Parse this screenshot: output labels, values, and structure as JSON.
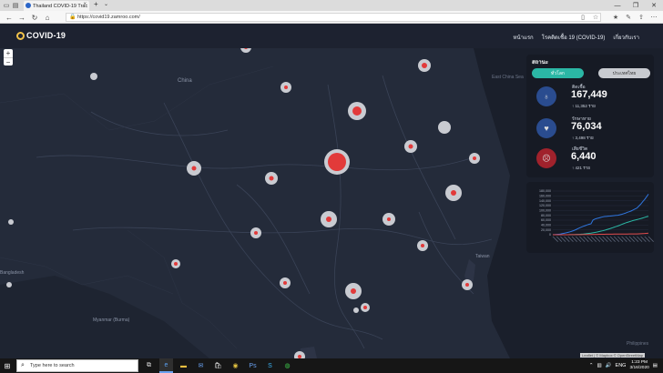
{
  "browser": {
    "tab_title": "Thailand COVID-19 Trac",
    "tab_close": "×",
    "new_tab": "+",
    "tab_dropdown": "⌄",
    "url": "https://covid19.zamroo.com/",
    "window_controls": [
      "—",
      "❐",
      "✕"
    ]
  },
  "app": {
    "logo_text": "COVID-19",
    "nav": [
      "หน้าแรก",
      "โรคติดเชื้อ 19 (COVID-19)",
      "เกี่ยวกับเรา"
    ]
  },
  "map": {
    "zoom_in": "+",
    "zoom_out": "−",
    "attribution": "Leaflet | © Mapbox © OpenStreetMap",
    "labels": [
      "China",
      "Taiwan",
      "Myanmar (Burma)",
      "Bangladesh",
      "East China Sea",
      "Philippines"
    ],
    "label_china": "China",
    "label_taiwan": "Taiwan",
    "label_myanmar": "Myanmar\n(Burma)",
    "label_bangladesh": "Bangladesh",
    "label_sea": "East China Sea",
    "label_phil": "Philippines"
  },
  "panel": {
    "title": "สถานะ",
    "tab_active": "ทั่วโลก",
    "tab_inactive": "ประเทศไทย",
    "stats": [
      {
        "label": "ติดเชื้อ",
        "value": "167,449",
        "delta": "↑ 11,352 ราย",
        "color": "#2a4c8f",
        "icon": "virus-icon"
      },
      {
        "label": "รักษาหาย",
        "value": "76,034",
        "delta": "↑ 3,498 ราย",
        "color": "#2a4c8f",
        "icon": "heart-icon"
      },
      {
        "label": "เสียชีวิต",
        "value": "6,440",
        "delta": "↑ 421 ราย",
        "color": "#a0222c",
        "icon": "skull-icon"
      }
    ]
  },
  "chart_data": {
    "type": "line",
    "yticks": [
      "180,000",
      "160,000",
      "140,000",
      "120,000",
      "100,000",
      "80,000",
      "60,000",
      "40,000",
      "20,000",
      "0"
    ],
    "ylim": [
      0,
      180000
    ],
    "series": [
      {
        "color": "#2f76e0",
        "values": [
          600,
          900,
          1400,
          2100,
          2900,
          4500,
          6100,
          7800,
          9800,
          11900,
          14600,
          17300,
          20600,
          24500,
          28300,
          31500,
          34900,
          37500,
          40500,
          43100,
          45200,
          60300,
          64400,
          67100,
          69000,
          71300,
          73300,
          75100,
          75600,
          76200,
          76800,
          77800,
          78800,
          79500,
          80300,
          82000,
          84000,
          86500,
          89000,
          92500,
          95000,
          98000,
          102000,
          106000,
          110000,
          118000,
          126000,
          136000,
          145000,
          156000,
          167449
        ]
      },
      {
        "color": "#2bb7a5",
        "values": [
          0,
          0,
          0,
          50,
          60,
          100,
          120,
          150,
          200,
          280,
          400,
          600,
          900,
          1200,
          1600,
          2200,
          2800,
          3600,
          4600,
          5600,
          6700,
          8100,
          9500,
          10900,
          12600,
          14400,
          16200,
          18100,
          20600,
          23100,
          25300,
          28000,
          31000,
          33500,
          36000,
          39000,
          42500,
          45500,
          48500,
          51000,
          53500,
          56000,
          58500,
          60500,
          62500,
          64500,
          66500,
          69000,
          71500,
          74000,
          76034
        ]
      },
      {
        "color": "#e04a4a",
        "values": [
          17,
          25,
          41,
          56,
          80,
          106,
          132,
          170,
          213,
          259,
          304,
          362,
          426,
          492,
          565,
          638,
          724,
          813,
          910,
          1018,
          1115,
          1368,
          1383,
          1526,
          1669,
          1775,
          1873,
          2009,
          2126,
          2247,
          2360,
          2460,
          2618,
          2699,
          2763,
          2800,
          2858,
          2923,
          2977,
          3050,
          3117,
          3202,
          3285,
          3387,
          3494,
          3809,
          4262,
          4615,
          5072,
          5819,
          6440
        ]
      }
    ]
  },
  "taskbar": {
    "search_placeholder": "Type here to search",
    "time": "1:23 PM",
    "date": "3/16/2020"
  }
}
